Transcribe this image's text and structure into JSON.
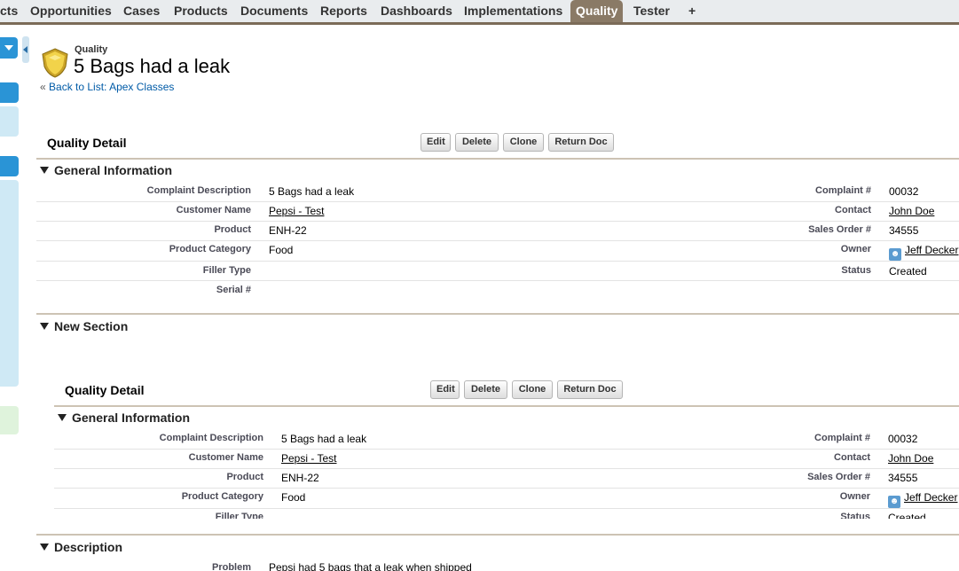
{
  "tabs": [
    "cts",
    "Opportunities",
    "Cases",
    "Products",
    "Documents",
    "Reports",
    "Dashboards",
    "Implementations",
    "Quality",
    "Tester",
    "+"
  ],
  "active_tab": "Quality",
  "header": {
    "object_label": "Quality",
    "record_title": "5 Bags had a leak",
    "back_prefix": "«",
    "back_link": "Back to List: Apex Classes"
  },
  "detail": {
    "title": "Quality Detail",
    "buttons": [
      "Edit",
      "Delete",
      "Clone",
      "Return Doc"
    ]
  },
  "sections": {
    "general": "General Information",
    "new_section": "New Section",
    "description": "Description"
  },
  "fields": {
    "complaint_description": {
      "label": "Complaint Description",
      "value": "5 Bags had a leak"
    },
    "customer_name": {
      "label": "Customer Name",
      "value": "Pepsi - Test"
    },
    "product": {
      "label": "Product",
      "value": "ENH-22"
    },
    "product_category": {
      "label": "Product Category",
      "value": "Food"
    },
    "filler_type": {
      "label": "Filler Type",
      "value": ""
    },
    "serial": {
      "label": "Serial #",
      "value": ""
    },
    "complaint_no": {
      "label": "Complaint #",
      "value": "00032"
    },
    "contact": {
      "label": "Contact",
      "value": "John Doe"
    },
    "sales_order": {
      "label": "Sales Order #",
      "value": "34555"
    },
    "owner": {
      "label": "Owner",
      "value": "Jeff Decker"
    },
    "status": {
      "label": "Status",
      "value": "Created"
    },
    "problem": {
      "label": "Problem",
      "value": "Pepsi had 5 bags that a leak when shipped"
    }
  },
  "colors": {
    "tab_active": "#8a7a66",
    "link": "#015ba7",
    "section_rule": "#cdc3b4",
    "sidebar_blue": "#2a94d6"
  }
}
